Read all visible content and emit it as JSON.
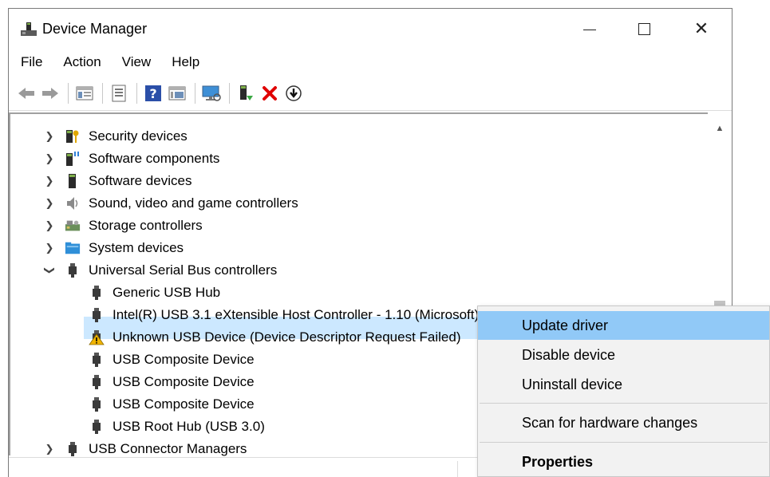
{
  "window": {
    "title": "Device Manager",
    "controls": {
      "minimize": "minimize",
      "maximize": "maximize",
      "close": "✕"
    }
  },
  "menubar": [
    "File",
    "Action",
    "View",
    "Help"
  ],
  "toolbar": [
    "back-arrow-icon",
    "forward-arrow-icon",
    "properties-icon",
    "update-driver-list-icon",
    "help-icon",
    "view-icon",
    "scan-hardware-icon",
    "enable-device-icon",
    "uninstall-icon",
    "download-icon"
  ],
  "tree": {
    "categories_above": [
      {
        "label": "Security devices",
        "icon": "security-key-icon"
      },
      {
        "label": "Software components",
        "icon": "software-component-icon"
      },
      {
        "label": "Software devices",
        "icon": "software-device-icon"
      },
      {
        "label": "Sound, video and game controllers",
        "icon": "speaker-icon"
      },
      {
        "label": "Storage controllers",
        "icon": "storage-controller-icon"
      },
      {
        "label": "System devices",
        "icon": "system-folder-icon"
      }
    ],
    "usb": {
      "label": "Universal Serial Bus controllers",
      "children": [
        {
          "label": "Generic USB Hub"
        },
        {
          "label": "Intel(R) USB 3.1 eXtensible Host Controller - 1.10 (Microsoft)"
        },
        {
          "label": "Unknown USB Device (Device Descriptor Request Failed)",
          "warning": true
        },
        {
          "label": "USB Composite Device"
        },
        {
          "label": "USB Composite Device"
        },
        {
          "label": "USB Composite Device"
        },
        {
          "label": "USB Root Hub (USB 3.0)"
        }
      ]
    },
    "after": {
      "label": "USB Connector Managers"
    }
  },
  "context_menu": {
    "update": "Update driver",
    "disable": "Disable device",
    "uninstall": "Uninstall device",
    "scan": "Scan for hardware changes",
    "properties": "Properties"
  },
  "colors": {
    "selection": "#cce8ff",
    "menu_highlight": "#91c9f7",
    "warning": "#f0b400",
    "red_x": "#e00000"
  }
}
